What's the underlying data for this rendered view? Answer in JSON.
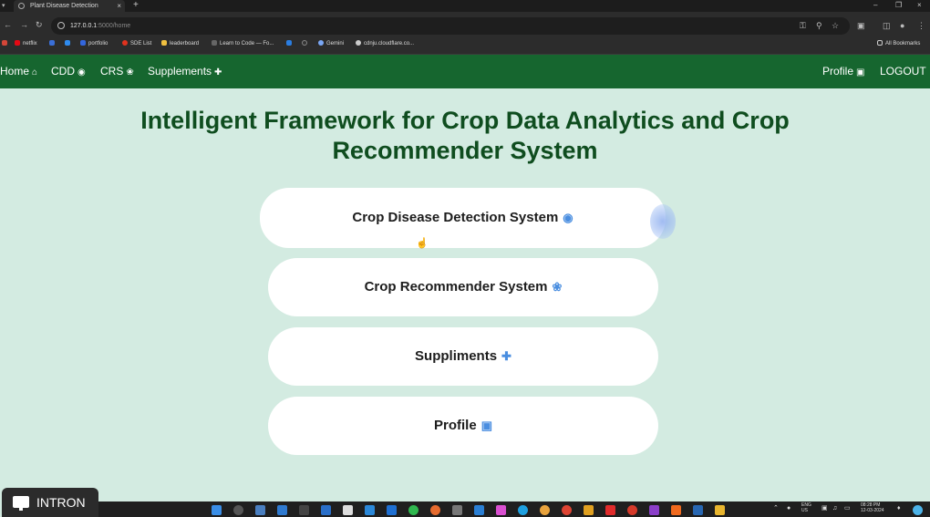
{
  "browser": {
    "tab_title": "Plant Disease Detection",
    "url_host": "127.0.0.1",
    "url_path": ":5000/home",
    "bookmarks": [
      "netflix",
      "portfolio",
      "SDE List",
      "leaderboard",
      "Learn to Code — Fo...",
      "Gemini",
      "cdnju.cloudflare.co...",
      "All Bookmarks"
    ]
  },
  "navbar": {
    "home": "Home",
    "cdd": "CDD",
    "crs": "CRS",
    "supplements": "Supplements",
    "profile": "Profile",
    "logout": "LOGOUT"
  },
  "main": {
    "title": "Intelligent Framework for Crop Data Analytics and Crop Recommender System",
    "cards": [
      {
        "label": "Crop Disease Detection System",
        "icon": "camera-icon"
      },
      {
        "label": "Crop Recommender System",
        "icon": "leaf-icon"
      },
      {
        "label": "Suppliments",
        "icon": "medkit-icon"
      },
      {
        "label": "Profile",
        "icon": "id-card-icon"
      }
    ]
  },
  "overlay": {
    "badge": "INTRON"
  },
  "taskbar": {
    "lang": "ENG",
    "region": "US",
    "time": "08:28 PM",
    "date": "12-03-2024"
  },
  "colors": {
    "navbar": "#16662f",
    "background": "#d3ebe1",
    "title": "#0f4d1f",
    "icon_accent": "#4a8ee0"
  }
}
